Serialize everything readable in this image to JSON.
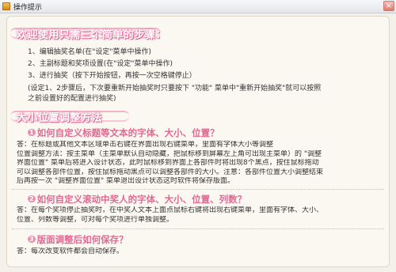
{
  "window": {
    "title": "操作提示",
    "close_glyph": "×"
  },
  "intro": {
    "heading": "欢迎使用只需三个简单的步骤：",
    "steps": [
      "1、编辑抽奖名单(在\"设定\"菜单中操作)",
      "2、主副标题和奖项设置(在\"设定\"菜单中操作)",
      "3、进行抽奖（按下开始按钮，再按一次空格键停止）"
    ],
    "note_lines": [
      "(设定1、2步骤后，下次要重新开始抽奖时只要按下 \"功能\" 菜单中\"重新开始抽奖\"就可以按照",
      "之前设置好的配置进行抽奖)"
    ]
  },
  "section2": {
    "heading": "大小位置调整方法"
  },
  "qa": [
    {
      "num": "1",
      "question": "如何自定义标题等文本的字体、大小、位置？",
      "answer_lines": [
        "答：在标题或其他文本区域单击右键在界面出现右键菜单，里面有字体大小等调整",
        "位置调整方法：按主菜单（主菜单默认自动隐藏，把鼠标移到屏幕左上角可出现主菜单）的 \"调整",
        "界面位置\" 菜单后将进入设计状态，此时鼠标移到界面上各部件时将出现8个黑点，按住鼠标拖动",
        "可以调整各部件位置，按住鼠标拖动黑点可以调整各部件的大小。注意：各部件位置大小调整结束",
        "后再按一次 \"调整界面位置\" 菜单退出设计状态这时软件将保存版面。"
      ]
    },
    {
      "num": "2",
      "question": "如何自定义滚动中奖人的字体、大小、位置、列数？",
      "answer_lines": [
        "答：在每个奖项停止抽奖时，在中奖人文本上面点鼠标右键将出现右键菜单，里面有字体、大小、",
        "位置、列数等调整，可对每个奖项进行单独调整。"
      ]
    },
    {
      "num": "3",
      "question": "版面调整后如何保存？",
      "answer_lines": [
        "答：每次改变软件都会自动保存。"
      ]
    }
  ]
}
